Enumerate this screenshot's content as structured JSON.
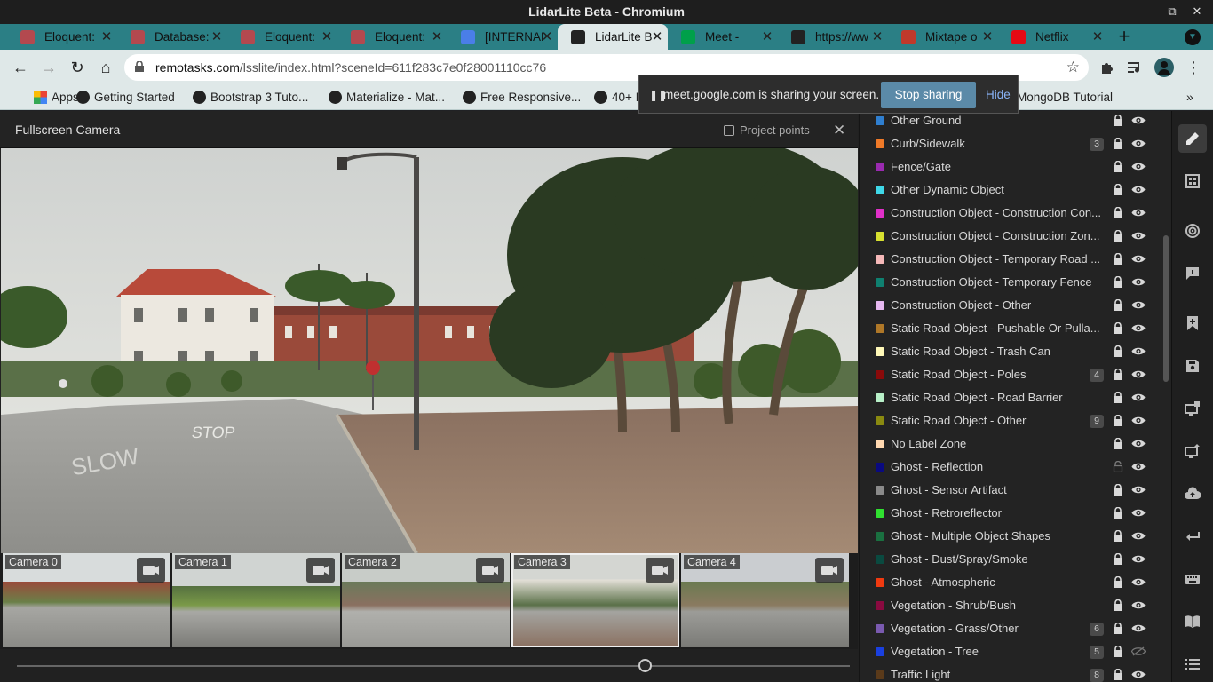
{
  "window": {
    "title": "LidarLite Beta - Chromium"
  },
  "tabs": [
    {
      "label": "Eloquent:",
      "icon": "laravel-icon",
      "color": "#b3494f"
    },
    {
      "label": "Database:",
      "icon": "laravel-icon",
      "color": "#b3494f"
    },
    {
      "label": "Eloquent:",
      "icon": "laravel-icon",
      "color": "#b3494f"
    },
    {
      "label": "Eloquent:",
      "icon": "laravel-icon",
      "color": "#b3494f"
    },
    {
      "label": "[INTERNAL",
      "icon": "docs-icon",
      "color": "#4a7ee8"
    },
    {
      "label": "LidarLite B",
      "icon": "globe-icon",
      "color": "#222222"
    },
    {
      "label": "Meet -",
      "icon": "meet-icon",
      "color": "#00a04a"
    },
    {
      "label": "https://ww",
      "icon": "globe-icon",
      "color": "#222222"
    },
    {
      "label": "Mixtape o",
      "icon": "mixtape-icon",
      "color": "#c0392b"
    },
    {
      "label": "Netflix",
      "icon": "netflix-icon",
      "color": "#e50914"
    }
  ],
  "address": {
    "host": "remotasks.com",
    "path": "/lsslite/index.html?sceneId=611f283c7e0f28001110cc76"
  },
  "bookmarks": [
    {
      "label": "Apps"
    },
    {
      "label": "Getting Started"
    },
    {
      "label": "Bootstrap 3 Tuto..."
    },
    {
      "label": "Materialize - Mat..."
    },
    {
      "label": "Free Responsive..."
    },
    {
      "label": "40+ I"
    },
    {
      "label": "MongoDB Tutorial"
    }
  ],
  "screenshare": {
    "message": "meet.google.com is sharing your screen.",
    "stop": "Stop sharing",
    "hide": "Hide"
  },
  "camera_panel": {
    "title": "Fullscreen Camera",
    "project_points": "Project points",
    "thumbnails": [
      {
        "label": "Camera 0",
        "selected": false
      },
      {
        "label": "Camera 1",
        "selected": false
      },
      {
        "label": "Camera 2",
        "selected": false
      },
      {
        "label": "Camera 3",
        "selected": true
      },
      {
        "label": "Camera 4",
        "selected": false
      }
    ],
    "timeline_position": 0.755
  },
  "labels": [
    {
      "name": "Other Ground",
      "color": "#2f7fd0",
      "count": "",
      "locked": true,
      "visible": true
    },
    {
      "name": "Curb/Sidewalk",
      "color": "#f07a28",
      "count": "3",
      "locked": true,
      "visible": true
    },
    {
      "name": "Fence/Gate",
      "color": "#9a2ab0",
      "count": "",
      "locked": true,
      "visible": true
    },
    {
      "name": "Other Dynamic Object",
      "color": "#3fd8e8",
      "count": "",
      "locked": true,
      "visible": true
    },
    {
      "name": "Construction Object - Construction Con...",
      "color": "#e030c8",
      "count": "",
      "locked": true,
      "visible": true
    },
    {
      "name": "Construction Object - Construction Zon...",
      "color": "#d8e030",
      "count": "",
      "locked": true,
      "visible": true
    },
    {
      "name": "Construction Object - Temporary Road ...",
      "color": "#f5b8b8",
      "count": "",
      "locked": true,
      "visible": true
    },
    {
      "name": "Construction Object - Temporary Fence",
      "color": "#0f8070",
      "count": "",
      "locked": true,
      "visible": true
    },
    {
      "name": "Construction Object - Other",
      "color": "#e6b8f0",
      "count": "",
      "locked": true,
      "visible": true
    },
    {
      "name": "Static Road Object - Pushable Or Pulla...",
      "color": "#b07828",
      "count": "",
      "locked": true,
      "visible": true
    },
    {
      "name": "Static Road Object - Trash Can",
      "color": "#fff8b8",
      "count": "",
      "locked": true,
      "visible": true
    },
    {
      "name": "Static Road Object - Poles",
      "color": "#8a0a0a",
      "count": "4",
      "locked": true,
      "visible": true
    },
    {
      "name": "Static Road Object - Road Barrier",
      "color": "#b8f0c8",
      "count": "",
      "locked": true,
      "visible": true
    },
    {
      "name": "Static Road Object - Other",
      "color": "#8a8a10",
      "count": "9",
      "locked": true,
      "visible": true
    },
    {
      "name": "No Label Zone",
      "color": "#ffd8b0",
      "count": "",
      "locked": true,
      "visible": true
    },
    {
      "name": "Ghost - Reflection",
      "color": "#0a0a80",
      "count": "",
      "locked": false,
      "visible": true
    },
    {
      "name": "Ghost - Sensor Artifact",
      "color": "#8a8a8a",
      "count": "",
      "locked": true,
      "visible": true
    },
    {
      "name": "Ghost - Retroreflector",
      "color": "#30e030",
      "count": "",
      "locked": true,
      "visible": true
    },
    {
      "name": "Ghost - Multiple Object Shapes",
      "color": "#1a7040",
      "count": "",
      "locked": true,
      "visible": true
    },
    {
      "name": "Ghost - Dust/Spray/Smoke",
      "color": "#0a4a40",
      "count": "",
      "locked": true,
      "visible": true
    },
    {
      "name": "Ghost - Atmospheric",
      "color": "#f03a10",
      "count": "",
      "locked": true,
      "visible": true
    },
    {
      "name": "Vegetation - Shrub/Bush",
      "color": "#8a0a40",
      "count": "",
      "locked": true,
      "visible": true
    },
    {
      "name": "Vegetation - Grass/Other",
      "color": "#7a5ab0",
      "count": "6",
      "locked": true,
      "visible": true
    },
    {
      "name": "Vegetation - Tree",
      "color": "#1a40e0",
      "count": "5",
      "locked": true,
      "visible": false
    },
    {
      "name": "Traffic Light",
      "color": "#5a3a1a",
      "count": "8",
      "locked": true,
      "visible": true
    }
  ],
  "rail": [
    {
      "icon": "paintbrush-icon",
      "active": true
    },
    {
      "icon": "table-icon",
      "active": false
    },
    {
      "icon": "radar-icon",
      "active": false
    },
    {
      "icon": "comment-icon",
      "active": false
    },
    {
      "icon": "add-bookmark-icon",
      "active": false
    },
    {
      "icon": "save-icon",
      "active": false
    },
    {
      "icon": "monitor-save-icon",
      "active": false
    },
    {
      "icon": "monitor-upload-icon",
      "active": false
    },
    {
      "icon": "cloud-upload-icon",
      "active": false
    },
    {
      "icon": "return-icon",
      "active": false
    },
    {
      "icon": "keyboard-icon",
      "active": false
    },
    {
      "icon": "book-icon",
      "active": false
    },
    {
      "icon": "list-icon",
      "active": false
    }
  ]
}
